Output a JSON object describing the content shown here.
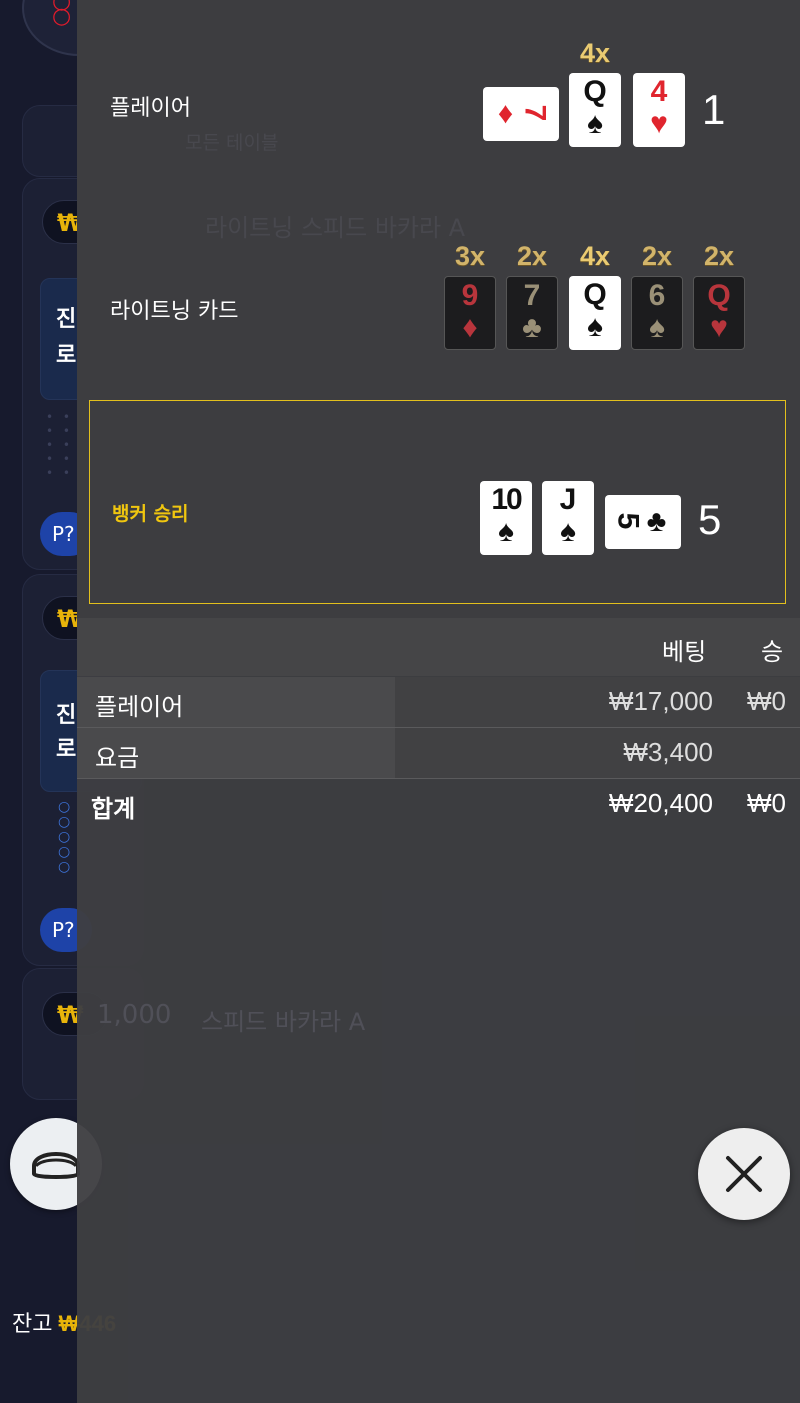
{
  "sections": {
    "player": {
      "label": "플레이어",
      "score": "1",
      "cards": [
        {
          "rank": "7",
          "suit": "♦",
          "color": "red",
          "sideways": true,
          "multiplier": ""
        },
        {
          "rank": "Q",
          "suit": "♠",
          "color": "black",
          "sideways": false,
          "multiplier": "4x"
        },
        {
          "rank": "4",
          "suit": "♥",
          "color": "red",
          "sideways": false,
          "multiplier": ""
        }
      ]
    },
    "lightning": {
      "label": "라이트닝 카드",
      "cards": [
        {
          "rank": "9",
          "suit": "♦",
          "color": "red",
          "multiplier": "3x"
        },
        {
          "rank": "7",
          "suit": "♣",
          "color": "black",
          "multiplier": "2x"
        },
        {
          "rank": "Q",
          "suit": "♠",
          "color": "black",
          "multiplier": "4x"
        },
        {
          "rank": "6",
          "suit": "♠",
          "color": "black",
          "multiplier": "2x"
        },
        {
          "rank": "Q",
          "suit": "♥",
          "color": "red",
          "multiplier": "2x"
        }
      ]
    },
    "banker": {
      "label": "뱅커 승리",
      "score": "5",
      "cards": [
        {
          "rank": "10",
          "suit": "♠",
          "color": "black",
          "sideways": false
        },
        {
          "rank": "J",
          "suit": "♠",
          "color": "black",
          "sideways": false
        },
        {
          "rank": "5",
          "suit": "♣",
          "color": "black",
          "sideways": true
        }
      ]
    }
  },
  "bet_table": {
    "header": {
      "bet": "베팅",
      "win": "승"
    },
    "rows": [
      {
        "name": "플레이어",
        "bet": "₩17,000",
        "win": "₩0"
      },
      {
        "name": "요금",
        "bet": "₩3,400",
        "win": ""
      }
    ],
    "total": {
      "name": "합계",
      "bet": "₩20,400",
      "win": "₩0"
    }
  },
  "background": {
    "currency_badge": "₩",
    "inner_text_1": "진",
    "inner_text_2": "로",
    "badge_label": "P?",
    "balance_label": "잔고",
    "balance_amount": "₩446",
    "ghost_1000": "1,000",
    "ghost_title_a": "라이트닝 스피드 바카라 A",
    "ghost_title_b": "스피드 바카라 A",
    "ghost_all_tables": "모든 테이블"
  },
  "colors": {
    "winner_border": "#e3c01d",
    "winner_label": "#f0c60f",
    "multiplier": "#d2b46a",
    "red_suit": "#e0252e",
    "panel": "#3d3d40"
  },
  "icons": {
    "close": "close-icon",
    "seat": "seat-icon"
  }
}
